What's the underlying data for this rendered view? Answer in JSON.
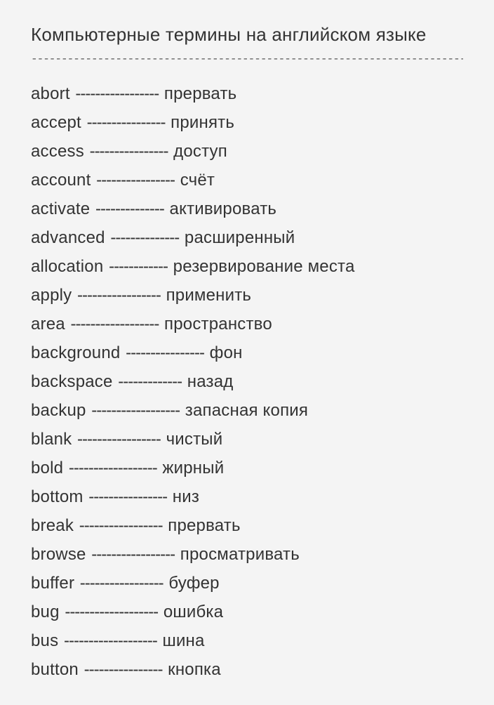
{
  "title": "Компьютерные термины на английском языке",
  "divider": "----------------------------------------------------------------------------------------------------------------------",
  "terms": [
    {
      "en": "abort",
      "sep": " ----------------- ",
      "ru": "прервать"
    },
    {
      "en": "accept",
      "sep": " ---------------- ",
      "ru": "принять"
    },
    {
      "en": "access",
      "sep": " ---------------- ",
      "ru": "доступ"
    },
    {
      "en": "account",
      "sep": " ---------------- ",
      "ru": "счёт"
    },
    {
      "en": "activate",
      "sep": " -------------- ",
      "ru": "активировать"
    },
    {
      "en": "advanced",
      "sep": " -------------- ",
      "ru": "расширенный"
    },
    {
      "en": "allocation",
      "sep": " ------------ ",
      "ru": "резервирование места"
    },
    {
      "en": "apply",
      "sep": " ----------------- ",
      "ru": "применить"
    },
    {
      "en": "area",
      "sep": " ------------------ ",
      "ru": "пространство"
    },
    {
      "en": "background",
      "sep": " ---------------- ",
      "ru": "фон"
    },
    {
      "en": "backspace",
      "sep": " ------------- ",
      "ru": "назад"
    },
    {
      "en": "backup",
      "sep": " ------------------ ",
      "ru": "запасная копия"
    },
    {
      "en": "blank",
      "sep": " ----------------- ",
      "ru": "чистый"
    },
    {
      "en": "bold",
      "sep": " ------------------ ",
      "ru": "жирный"
    },
    {
      "en": "bottom",
      "sep": " ---------------- ",
      "ru": "низ"
    },
    {
      "en": "break",
      "sep": " ----------------- ",
      "ru": "прервать"
    },
    {
      "en": "browse",
      "sep": " ----------------- ",
      "ru": "просматривать"
    },
    {
      "en": "buffer",
      "sep": " ----------------- ",
      "ru": "буфер"
    },
    {
      "en": "bug",
      "sep": " ------------------- ",
      "ru": "ошибка"
    },
    {
      "en": "bus",
      "sep": " ------------------- ",
      "ru": "шина"
    },
    {
      "en": "button",
      "sep": " ---------------- ",
      "ru": "кнопка"
    }
  ]
}
